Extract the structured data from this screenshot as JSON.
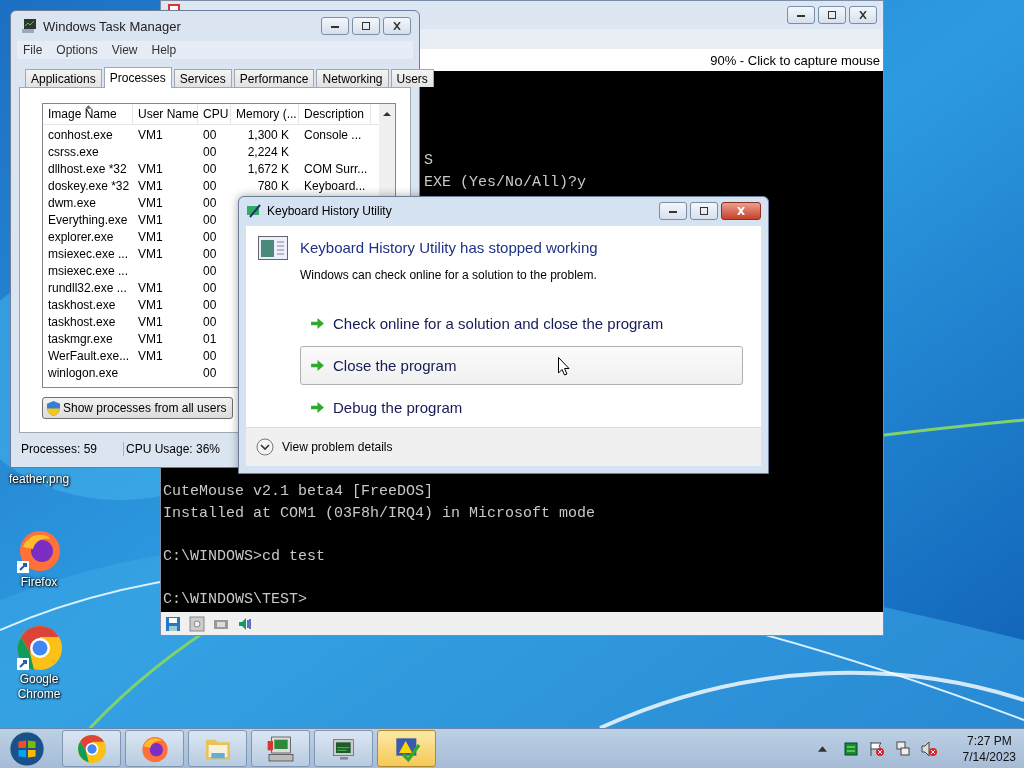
{
  "desktop": {
    "icons": [
      {
        "label": "feather.png",
        "kind": "label"
      },
      {
        "label": "Firefox",
        "kind": "firefox"
      },
      {
        "label": "Google Chrome",
        "kind": "chrome"
      }
    ]
  },
  "vm_window": {
    "status": "90% - Click to capture mouse",
    "console_lines": [
      "S",
      "EXE (Yes/No/All)?y",
      "CuteMouse v2.1 beta4 [FreeDOS]",
      "Installed at COM1 (03F8h/IRQ4) in Microsoft mode",
      "C:\\WINDOWS>cd test",
      "C:\\WINDOWS\\TEST>"
    ]
  },
  "task_manager": {
    "title": "Windows Task Manager",
    "menu": [
      "File",
      "Options",
      "View",
      "Help"
    ],
    "tabs": [
      {
        "label": "Applications",
        "selected": false
      },
      {
        "label": "Processes",
        "selected": true
      },
      {
        "label": "Services",
        "selected": false
      },
      {
        "label": "Performance",
        "selected": false
      },
      {
        "label": "Networking",
        "selected": false
      },
      {
        "label": "Users",
        "selected": false
      }
    ],
    "columns": [
      {
        "label": "Image Name",
        "sorted": true
      },
      {
        "label": "User Name",
        "sorted": false
      },
      {
        "label": "CPU",
        "sorted": false
      },
      {
        "label": "Memory (...",
        "sorted": false
      },
      {
        "label": "Description",
        "sorted": false
      }
    ],
    "rows": [
      {
        "image": "conhost.exe",
        "user": "VM1",
        "cpu": "00",
        "memory": "1,300 K",
        "description": "Console ..."
      },
      {
        "image": "csrss.exe",
        "cpu": "00",
        "memory": "2,224 K"
      },
      {
        "image": "dllhost.exe *32",
        "user": "VM1",
        "cpu": "00",
        "memory": "1,672 K",
        "description": "COM Surr..."
      },
      {
        "image": "doskey.exe *32",
        "user": "VM1",
        "cpu": "00",
        "memory": "780 K",
        "description": "Keyboard..."
      },
      {
        "image": "dwm.exe",
        "user": "VM1",
        "cpu": "00"
      },
      {
        "image": "Everything.exe",
        "user": "VM1",
        "cpu": "00"
      },
      {
        "image": "explorer.exe",
        "user": "VM1",
        "cpu": "00"
      },
      {
        "image": "msiexec.exe ...",
        "user": "VM1",
        "cpu": "00"
      },
      {
        "image": "msiexec.exe ...",
        "cpu": "00"
      },
      {
        "image": "rundll32.exe ...",
        "user": "VM1",
        "cpu": "00"
      },
      {
        "image": "taskhost.exe",
        "user": "VM1",
        "cpu": "00"
      },
      {
        "image": "taskhost.exe",
        "user": "VM1",
        "cpu": "00"
      },
      {
        "image": "taskmgr.exe",
        "user": "VM1",
        "cpu": "01"
      },
      {
        "image": "WerFault.exe...",
        "user": "VM1",
        "cpu": "00"
      },
      {
        "image": "winlogon.exe",
        "cpu": "00"
      }
    ],
    "button": "Show processes from all users",
    "status": [
      "Processes: 59",
      "CPU Usage: 36%"
    ]
  },
  "dialog": {
    "title": "Keyboard History Utility",
    "heading": "Keyboard History Utility has stopped working",
    "message": "Windows can check online for a solution to the problem.",
    "options": [
      {
        "label": "Check online for a solution and close the program",
        "selected": false
      },
      {
        "label": "Close the program",
        "selected": true
      },
      {
        "label": "Debug the program",
        "selected": false
      }
    ],
    "details": "View problem details"
  },
  "taskbar": {
    "apps": [
      {
        "kind": "chrome",
        "active": false
      },
      {
        "kind": "firefox",
        "active": false
      },
      {
        "kind": "folder",
        "active": false
      },
      {
        "kind": "computer",
        "active": false
      },
      {
        "kind": "monitor",
        "active": false
      },
      {
        "kind": "warning",
        "active": true
      }
    ],
    "time": "7:27 PM",
    "date": "7/14/2023"
  }
}
